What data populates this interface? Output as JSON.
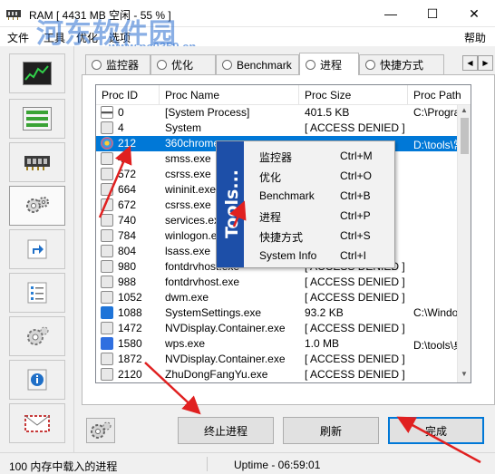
{
  "window": {
    "title": "RAM [ 4431 MB 空闲 - 55 % ]",
    "min": "—",
    "max": "☐",
    "close": "✕"
  },
  "watermark": {
    "brand": "河东软件园",
    "url": "www.pc0359.cn"
  },
  "menu": {
    "items": [
      "文件",
      "工具",
      "优化",
      "选项"
    ],
    "help": "帮助"
  },
  "tabs": [
    {
      "label": "监控器"
    },
    {
      "label": "优化"
    },
    {
      "label": "Benchmark"
    },
    {
      "label": "进程",
      "active": true
    },
    {
      "label": "快捷方式"
    }
  ],
  "table": {
    "columns": [
      "Proc ID",
      "Proc Name",
      "Proc Size",
      "Proc Path"
    ],
    "rows": [
      {
        "id": "0",
        "name": "[System Process]",
        "size": "401.5 KB",
        "path": "C:\\Program",
        "icon": "sys"
      },
      {
        "id": "4",
        "name": "System",
        "size": "[ ACCESS DENIED ]",
        "path": "",
        "icon": "gear"
      },
      {
        "id": "212",
        "name": "360chrome.",
        "size": "",
        "path": "D:\\tools\\常",
        "icon": "globe",
        "selected": true
      },
      {
        "id": "40",
        "name": "smss.exe",
        "size": "",
        "path": "",
        "icon": "gear"
      },
      {
        "id": "572",
        "name": "csrss.exe",
        "size": "",
        "path": "",
        "icon": "gear"
      },
      {
        "id": "664",
        "name": "wininit.exe",
        "size": "",
        "path": "",
        "icon": "gear"
      },
      {
        "id": "672",
        "name": "csrss.exe",
        "size": "",
        "path": "",
        "icon": "gear"
      },
      {
        "id": "740",
        "name": "services.exe",
        "size": "",
        "path": "",
        "icon": "gear"
      },
      {
        "id": "784",
        "name": "winlogon.exe",
        "size": "",
        "path": "",
        "icon": "gear"
      },
      {
        "id": "804",
        "name": "lsass.exe",
        "size": "",
        "path": "",
        "icon": "gear"
      },
      {
        "id": "980",
        "name": "fontdrvhost.exe",
        "size": "[ ACCESS DENIED ]",
        "path": "",
        "icon": "gear"
      },
      {
        "id": "988",
        "name": "fontdrvhost.exe",
        "size": "[ ACCESS DENIED ]",
        "path": "",
        "icon": "gear"
      },
      {
        "id": "1052",
        "name": "dwm.exe",
        "size": "[ ACCESS DENIED ]",
        "path": "",
        "icon": "gear"
      },
      {
        "id": "1088",
        "name": "SystemSettings.exe",
        "size": "93.2 KB",
        "path": "C:\\Window",
        "icon": "blue"
      },
      {
        "id": "1472",
        "name": "NVDisplay.Container.exe",
        "size": "[ ACCESS DENIED ]",
        "path": "",
        "icon": "gear"
      },
      {
        "id": "1580",
        "name": "wps.exe",
        "size": "1.0 MB",
        "path": "D:\\tools\\桌",
        "icon": "wps"
      },
      {
        "id": "1872",
        "name": "NVDisplay.Container.exe",
        "size": "[ ACCESS DENIED ]",
        "path": "",
        "icon": "gear"
      },
      {
        "id": "2120",
        "name": "ZhuDongFangYu.exe",
        "size": "[ ACCESS DENIED ]",
        "path": "",
        "icon": "gear"
      }
    ]
  },
  "context_menu": {
    "side_label": "Tools...",
    "items": [
      {
        "label": "监控器",
        "key": "Ctrl+M"
      },
      {
        "label": "优化",
        "key": "Ctrl+O"
      },
      {
        "label": "Benchmark",
        "key": "Ctrl+B"
      },
      {
        "label": "进程",
        "key": "Ctrl+P"
      },
      {
        "label": "快捷方式",
        "key": "Ctrl+S"
      },
      {
        "label": "System Info",
        "key": "Ctrl+I"
      }
    ]
  },
  "buttons": {
    "kill": "终止进程",
    "refresh": "刷新",
    "done": "完成"
  },
  "status": {
    "left": "100 内存中载入的进程",
    "uptime": "Uptime - 06:59:01"
  },
  "colors": {
    "selection": "#0078d7",
    "tools_banner": "#1d4fa8",
    "arrow": "#e02020"
  }
}
